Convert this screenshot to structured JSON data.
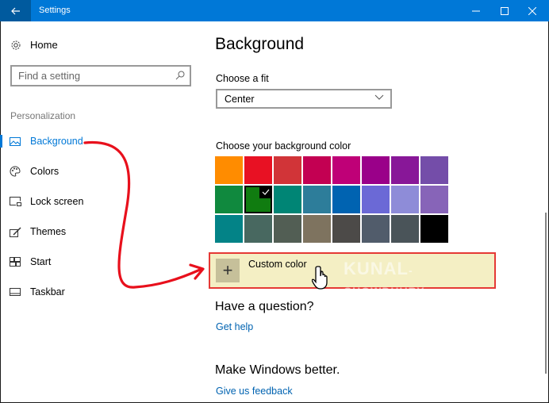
{
  "window": {
    "title": "Settings",
    "back_icon": "back-arrow-icon",
    "controls": [
      "minimize",
      "maximize",
      "close"
    ]
  },
  "sidebar": {
    "home_label": "Home",
    "search_placeholder": "Find a setting",
    "search_value": "",
    "section_label": "Personalization",
    "items": [
      {
        "label": "Background",
        "icon": "picture-icon",
        "active": true
      },
      {
        "label": "Colors",
        "icon": "palette-icon",
        "active": false
      },
      {
        "label": "Lock screen",
        "icon": "lock-screen-icon",
        "active": false
      },
      {
        "label": "Themes",
        "icon": "themes-icon",
        "active": false
      },
      {
        "label": "Start",
        "icon": "start-icon",
        "active": false
      },
      {
        "label": "Taskbar",
        "icon": "taskbar-icon",
        "active": false
      }
    ]
  },
  "main": {
    "title": "Background",
    "fit_label": "Choose a fit",
    "fit_value": "Center",
    "color_label": "Choose your background color",
    "colors": [
      "#ff8c00",
      "#e81123",
      "#d13438",
      "#c30052",
      "#bf0077",
      "#9a0089",
      "#881798",
      "#744da9",
      "#10893e",
      "#107c10",
      "#008575",
      "#2d7d9a",
      "#0063b1",
      "#6b69d6",
      "#8e8cd8",
      "#8764b8",
      "#038387",
      "#486860",
      "#525e54",
      "#7e735f",
      "#4c4a48",
      "#515c6b",
      "#4a5459",
      "#000000"
    ],
    "selected_color_index": 9,
    "custom_color_label": "Custom color",
    "question_title": "Have a question?",
    "help_link": "Get help",
    "better_title": "Make Windows better.",
    "feedback_link": "Give us feedback"
  },
  "annotation": {
    "watermark": "KUNAL",
    "watermark_suffix": "-CHOWDHURY",
    "accent_color": "#e81123"
  }
}
